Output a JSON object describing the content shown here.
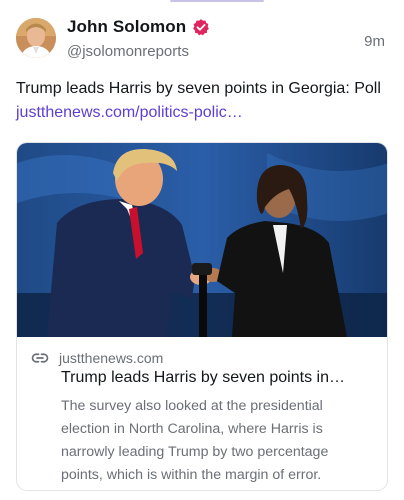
{
  "post": {
    "author": {
      "display_name": "John Solomon",
      "handle": "@jsolomonreports",
      "verified": true,
      "avatar_icon": "avatar-photo"
    },
    "time": "9m",
    "text": "Trump leads Harris by seven points in Georgia: Poll ",
    "link_text": "justthenews.com/politics-polic…"
  },
  "card": {
    "image_icon": "trump-harris-handshake-photo",
    "domain": "justthenews.com",
    "title": "Trump leads Harris by seven points in…",
    "description": "The survey also looked at the presidential election in North Carolina, where Harris is narrowly leading Trump by two percentage points, which is within the margin of error."
  },
  "colors": {
    "link": "#5b3fd4",
    "verified_badge": "#e0245e",
    "muted_text": "#6b6f76"
  }
}
